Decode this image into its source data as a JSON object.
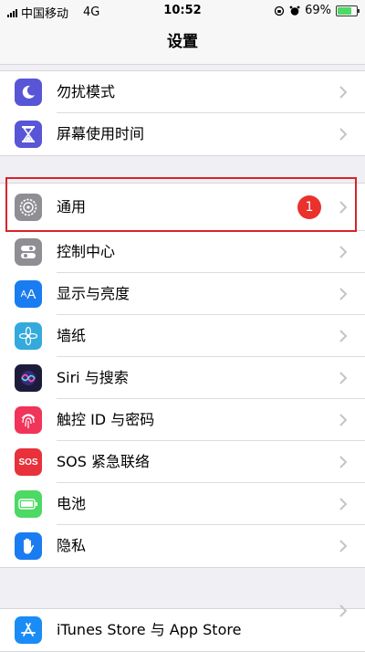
{
  "status": {
    "carrier": "中国移动",
    "network": "4G",
    "time": "10:52",
    "battery": "69%"
  },
  "title": "设置",
  "group1": [
    {
      "label": "勿扰模式"
    },
    {
      "label": "屏幕使用时间"
    }
  ],
  "general": {
    "label": "通用",
    "badge": "1"
  },
  "group2": [
    {
      "label": "控制中心"
    },
    {
      "label": "显示与亮度"
    },
    {
      "label": "墙纸"
    },
    {
      "label": "Siri 与搜索"
    },
    {
      "label": "触控 ID 与密码"
    },
    {
      "label": "SOS 紧急联络",
      "icon_text": "SOS"
    },
    {
      "label": "电池"
    },
    {
      "label": "隐私"
    }
  ],
  "group3": [
    {
      "label": "iTunes Store 与 App Store"
    }
  ],
  "colors": {
    "accent_red": "#d8232a",
    "badge": "#e9312d"
  }
}
